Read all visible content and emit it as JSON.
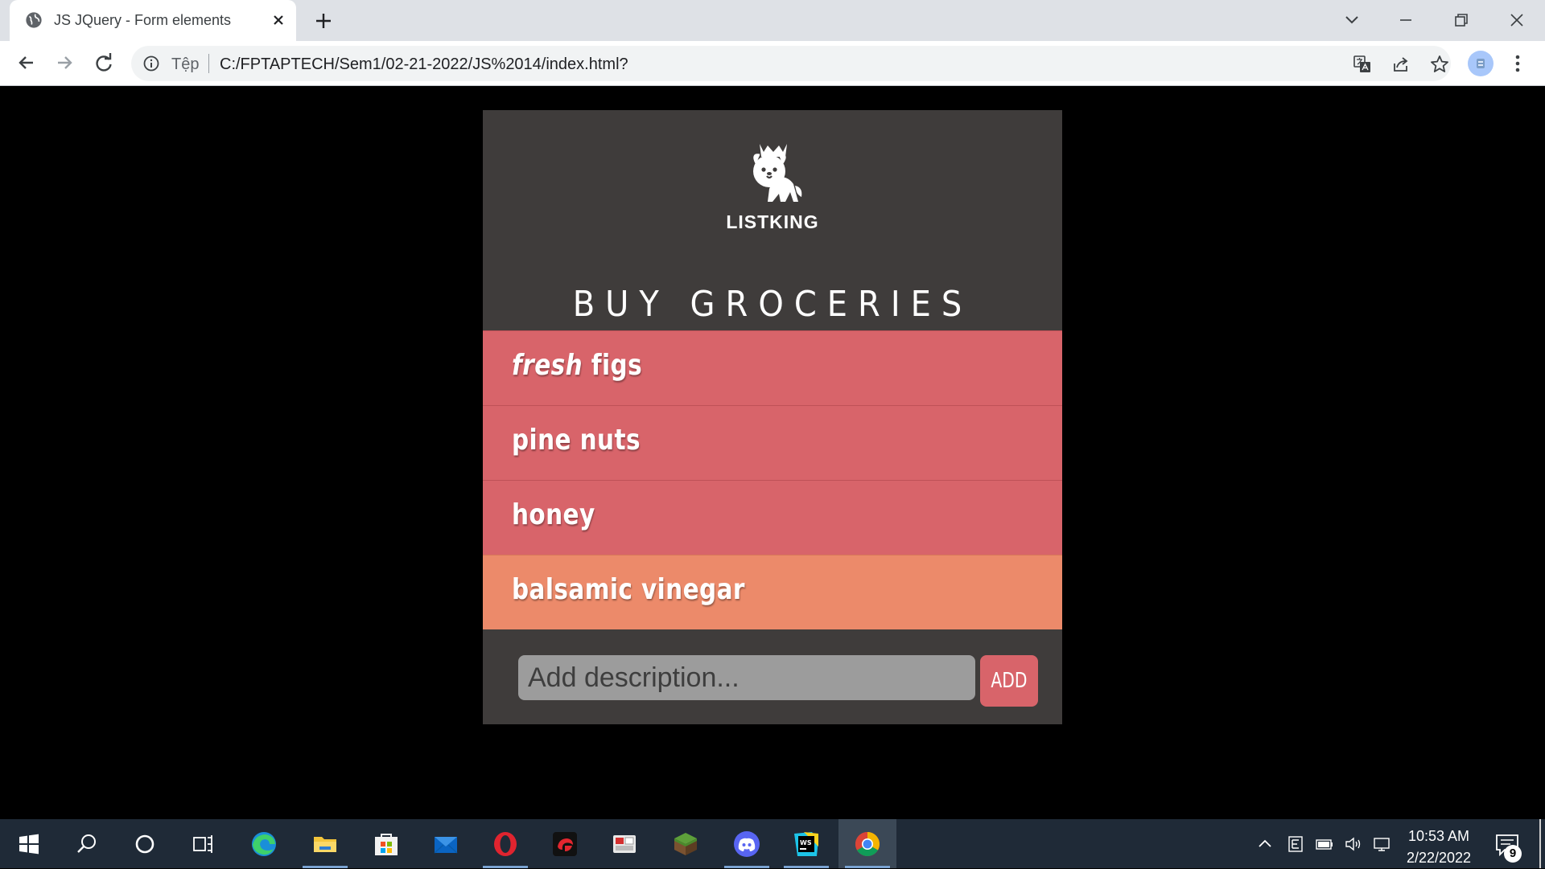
{
  "browser": {
    "tab_title": "JS JQuery - Form elements",
    "scheme_label": "Tệp",
    "url": "C:/FPTAPTECH/Sem1/02-21-2022/JS%2014/index.html?"
  },
  "app": {
    "logo_text": "LISTKING",
    "list_title": "BUY GROCERIES",
    "items": [
      {
        "emphasis": "fresh",
        "text": " figs",
        "status": "open"
      },
      {
        "emphasis": "",
        "text": "pine nuts",
        "status": "open"
      },
      {
        "emphasis": "",
        "text": "honey",
        "status": "open"
      },
      {
        "emphasis": "",
        "text": "balsamic vinegar",
        "status": "done"
      }
    ],
    "input_placeholder": "Add description...",
    "input_value": "",
    "add_label": "ADD",
    "colors": {
      "panel": "#3f3c3b",
      "item_open": "#d8646a",
      "item_done": "#ec8a6a",
      "button": "#d8646a"
    }
  },
  "taskbar": {
    "apps": [
      "start-icon",
      "search-icon",
      "cortana-icon",
      "task-view-icon",
      "edge-icon",
      "file-explorer-icon",
      "store-icon",
      "mail-icon",
      "opera-icon",
      "garena-icon",
      "unikey-icon",
      "minecraft-icon",
      "discord-icon",
      "webstorm-icon",
      "chrome-icon"
    ],
    "time": "10:53 AM",
    "date": "2/22/2022",
    "notification_count": "9"
  }
}
